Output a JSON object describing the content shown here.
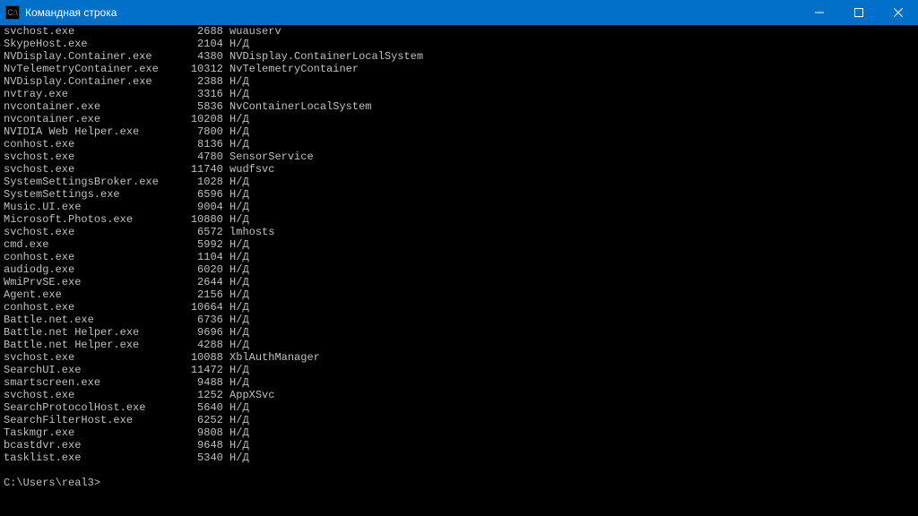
{
  "title": "Командная строка",
  "prompt": "C:\\Users\\real3>",
  "processes": [
    {
      "name": "svchost.exe",
      "pid": 2688,
      "svc": "wuauserv"
    },
    {
      "name": "SkypeHost.exe",
      "pid": 2104,
      "svc": "Н/Д"
    },
    {
      "name": "NVDisplay.Container.exe",
      "pid": 4380,
      "svc": "NVDisplay.ContainerLocalSystem"
    },
    {
      "name": "NvTelemetryContainer.exe",
      "pid": 10312,
      "svc": "NvTelemetryContainer"
    },
    {
      "name": "NVDisplay.Container.exe",
      "pid": 2388,
      "svc": "Н/Д"
    },
    {
      "name": "nvtray.exe",
      "pid": 3316,
      "svc": "Н/Д"
    },
    {
      "name": "nvcontainer.exe",
      "pid": 5836,
      "svc": "NvContainerLocalSystem"
    },
    {
      "name": "nvcontainer.exe",
      "pid": 10208,
      "svc": "Н/Д"
    },
    {
      "name": "NVIDIA Web Helper.exe",
      "pid": 7800,
      "svc": "Н/Д"
    },
    {
      "name": "conhost.exe",
      "pid": 8136,
      "svc": "Н/Д"
    },
    {
      "name": "svchost.exe",
      "pid": 4780,
      "svc": "SensorService"
    },
    {
      "name": "svchost.exe",
      "pid": 11740,
      "svc": "wudfsvc"
    },
    {
      "name": "SystemSettingsBroker.exe",
      "pid": 1028,
      "svc": "Н/Д"
    },
    {
      "name": "SystemSettings.exe",
      "pid": 6596,
      "svc": "Н/Д"
    },
    {
      "name": "Music.UI.exe",
      "pid": 9004,
      "svc": "Н/Д"
    },
    {
      "name": "Microsoft.Photos.exe",
      "pid": 10880,
      "svc": "Н/Д"
    },
    {
      "name": "svchost.exe",
      "pid": 6572,
      "svc": "lmhosts"
    },
    {
      "name": "cmd.exe",
      "pid": 5992,
      "svc": "Н/Д"
    },
    {
      "name": "conhost.exe",
      "pid": 1104,
      "svc": "Н/Д"
    },
    {
      "name": "audiodg.exe",
      "pid": 6020,
      "svc": "Н/Д"
    },
    {
      "name": "WmiPrvSE.exe",
      "pid": 2644,
      "svc": "Н/Д"
    },
    {
      "name": "Agent.exe",
      "pid": 2156,
      "svc": "Н/Д"
    },
    {
      "name": "conhost.exe",
      "pid": 10664,
      "svc": "Н/Д"
    },
    {
      "name": "Battle.net.exe",
      "pid": 6736,
      "svc": "Н/Д"
    },
    {
      "name": "Battle.net Helper.exe",
      "pid": 9696,
      "svc": "Н/Д"
    },
    {
      "name": "Battle.net Helper.exe",
      "pid": 4288,
      "svc": "Н/Д"
    },
    {
      "name": "svchost.exe",
      "pid": 10088,
      "svc": "XblAuthManager"
    },
    {
      "name": "SearchUI.exe",
      "pid": 11472,
      "svc": "Н/Д"
    },
    {
      "name": "smartscreen.exe",
      "pid": 9488,
      "svc": "Н/Д"
    },
    {
      "name": "svchost.exe",
      "pid": 1252,
      "svc": "AppXSvc"
    },
    {
      "name": "SearchProtocolHost.exe",
      "pid": 5640,
      "svc": "Н/Д"
    },
    {
      "name": "SearchFilterHost.exe",
      "pid": 6252,
      "svc": "Н/Д"
    },
    {
      "name": "Taskmgr.exe",
      "pid": 9808,
      "svc": "Н/Д"
    },
    {
      "name": "bcastdvr.exe",
      "pid": 9648,
      "svc": "Н/Д"
    },
    {
      "name": "tasklist.exe",
      "pid": 5340,
      "svc": "Н/Д"
    }
  ]
}
